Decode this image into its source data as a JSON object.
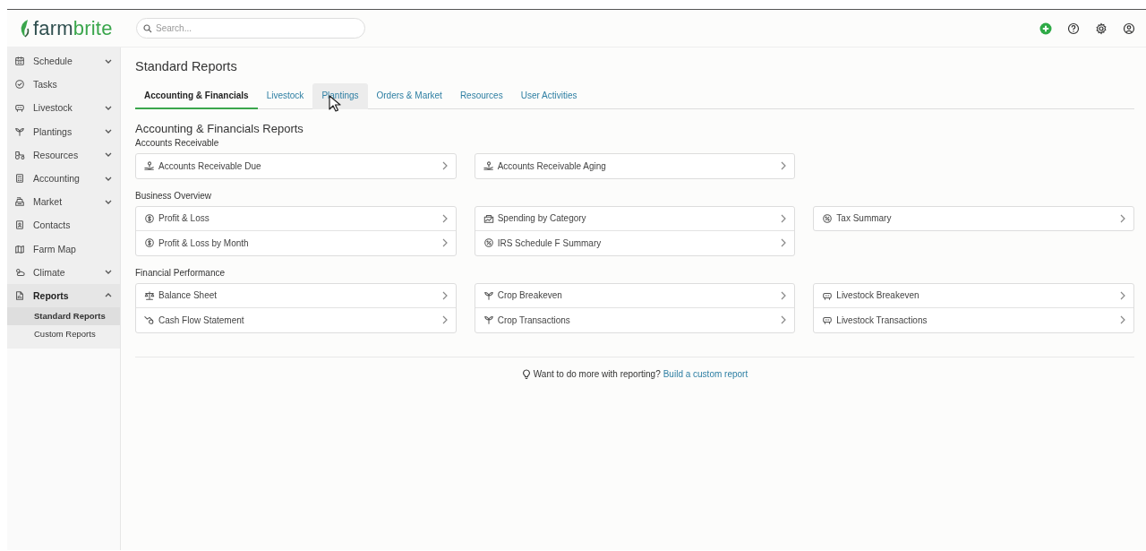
{
  "header": {
    "logo": {
      "left": "farm",
      "right": "brite"
    },
    "search": {
      "placeholder": "Search..."
    }
  },
  "sidebar": {
    "items": [
      {
        "label": "Schedule",
        "kind": "calendar",
        "expanded": false,
        "selected": false
      },
      {
        "label": "Tasks",
        "kind": "check",
        "selected": false
      },
      {
        "label": "Livestock",
        "kind": "cow",
        "expanded": false,
        "selected": false
      },
      {
        "label": "Plantings",
        "kind": "sprout",
        "expanded": false,
        "selected": false
      },
      {
        "label": "Resources",
        "kind": "tractor",
        "expanded": false,
        "selected": false
      },
      {
        "label": "Accounting",
        "kind": "calculator",
        "expanded": false,
        "selected": false
      },
      {
        "label": "Market",
        "kind": "register",
        "expanded": false,
        "selected": false
      },
      {
        "label": "Contacts",
        "kind": "contact",
        "selected": false
      },
      {
        "label": "Farm Map",
        "kind": "map",
        "selected": false
      },
      {
        "label": "Climate",
        "kind": "cloud",
        "expanded": false,
        "selected": false
      },
      {
        "label": "Reports",
        "kind": "report",
        "expanded": true,
        "selected": true,
        "children": [
          {
            "label": "Standard Reports",
            "selected": true
          },
          {
            "label": "Custom Reports",
            "selected": false
          }
        ]
      }
    ]
  },
  "page": {
    "title": "Standard Reports",
    "tabs": [
      {
        "label": "Accounting & Financials",
        "selected": true,
        "hovered": false
      },
      {
        "label": "Livestock",
        "selected": false,
        "hovered": false
      },
      {
        "label": "Plantings",
        "selected": false,
        "hovered": true
      },
      {
        "label": "Orders & Market",
        "selected": false,
        "hovered": false
      },
      {
        "label": "Resources",
        "selected": false,
        "hovered": false
      },
      {
        "label": "User Activities",
        "selected": false,
        "hovered": false
      }
    ],
    "section_title": "Accounting & Financials Reports",
    "groups": [
      {
        "title": "Accounts Receivable",
        "columns": [
          [
            {
              "label": "Accounts Receivable Due",
              "kind": "receivable"
            }
          ],
          [
            {
              "label": "Accounts Receivable Aging",
              "kind": "receivable"
            }
          ]
        ]
      },
      {
        "title": "Business Overview",
        "columns": [
          [
            {
              "label": "Profit & Loss",
              "kind": "dollar"
            },
            {
              "label": "Profit & Loss by Month",
              "kind": "dollar"
            }
          ],
          [
            {
              "label": "Spending by Category",
              "kind": "spending"
            },
            {
              "label": "IRS Schedule F Summary",
              "kind": "percent"
            }
          ],
          [
            {
              "label": "Tax Summary",
              "kind": "percent"
            }
          ]
        ]
      },
      {
        "title": "Financial Performance",
        "columns": [
          [
            {
              "label": "Balance Sheet",
              "kind": "balance"
            },
            {
              "label": "Cash Flow Statement",
              "kind": "cashflow"
            }
          ],
          [
            {
              "label": "Crop Breakeven",
              "kind": "crop"
            },
            {
              "label": "Crop Transactions",
              "kind": "crop"
            }
          ],
          [
            {
              "label": "Livestock Breakeven",
              "kind": "livestock"
            },
            {
              "label": "Livestock Transactions",
              "kind": "livestock"
            }
          ]
        ]
      }
    ],
    "footer": {
      "text": "Want to do more with reporting?",
      "link": "Build a custom report"
    }
  }
}
